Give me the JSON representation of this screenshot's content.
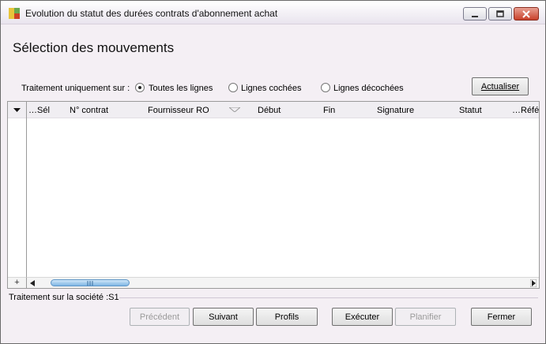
{
  "window": {
    "title": "Evolution du statut des durées contrats d'abonnement achat",
    "icon": "app-icon"
  },
  "heading": "Sélection des mouvements",
  "filter": {
    "label": "Traitement uniquement sur :",
    "options": [
      {
        "label": "Toutes les lignes",
        "checked": true
      },
      {
        "label": "Lignes cochées",
        "checked": false
      },
      {
        "label": "Lignes décochées",
        "checked": false
      }
    ],
    "refresh_label": "Actualiser"
  },
  "grid": {
    "columns": [
      "…Sél",
      "N° contrat",
      "Fournisseur RO",
      "Début",
      "Fin",
      "Signature",
      "Statut",
      "…Réfé"
    ],
    "rows": [],
    "add_row_label": "+"
  },
  "status": {
    "text": "Traitement sur la société :S1"
  },
  "buttons": {
    "previous": "Précédent",
    "next": "Suivant",
    "profiles": "Profils",
    "execute": "Exécuter",
    "schedule": "Planifier",
    "close": "Fermer"
  },
  "colors": {
    "window_bg": "#f4eff4",
    "scroll_thumb": "#7fb6e4",
    "close_button": "#c9402a"
  }
}
